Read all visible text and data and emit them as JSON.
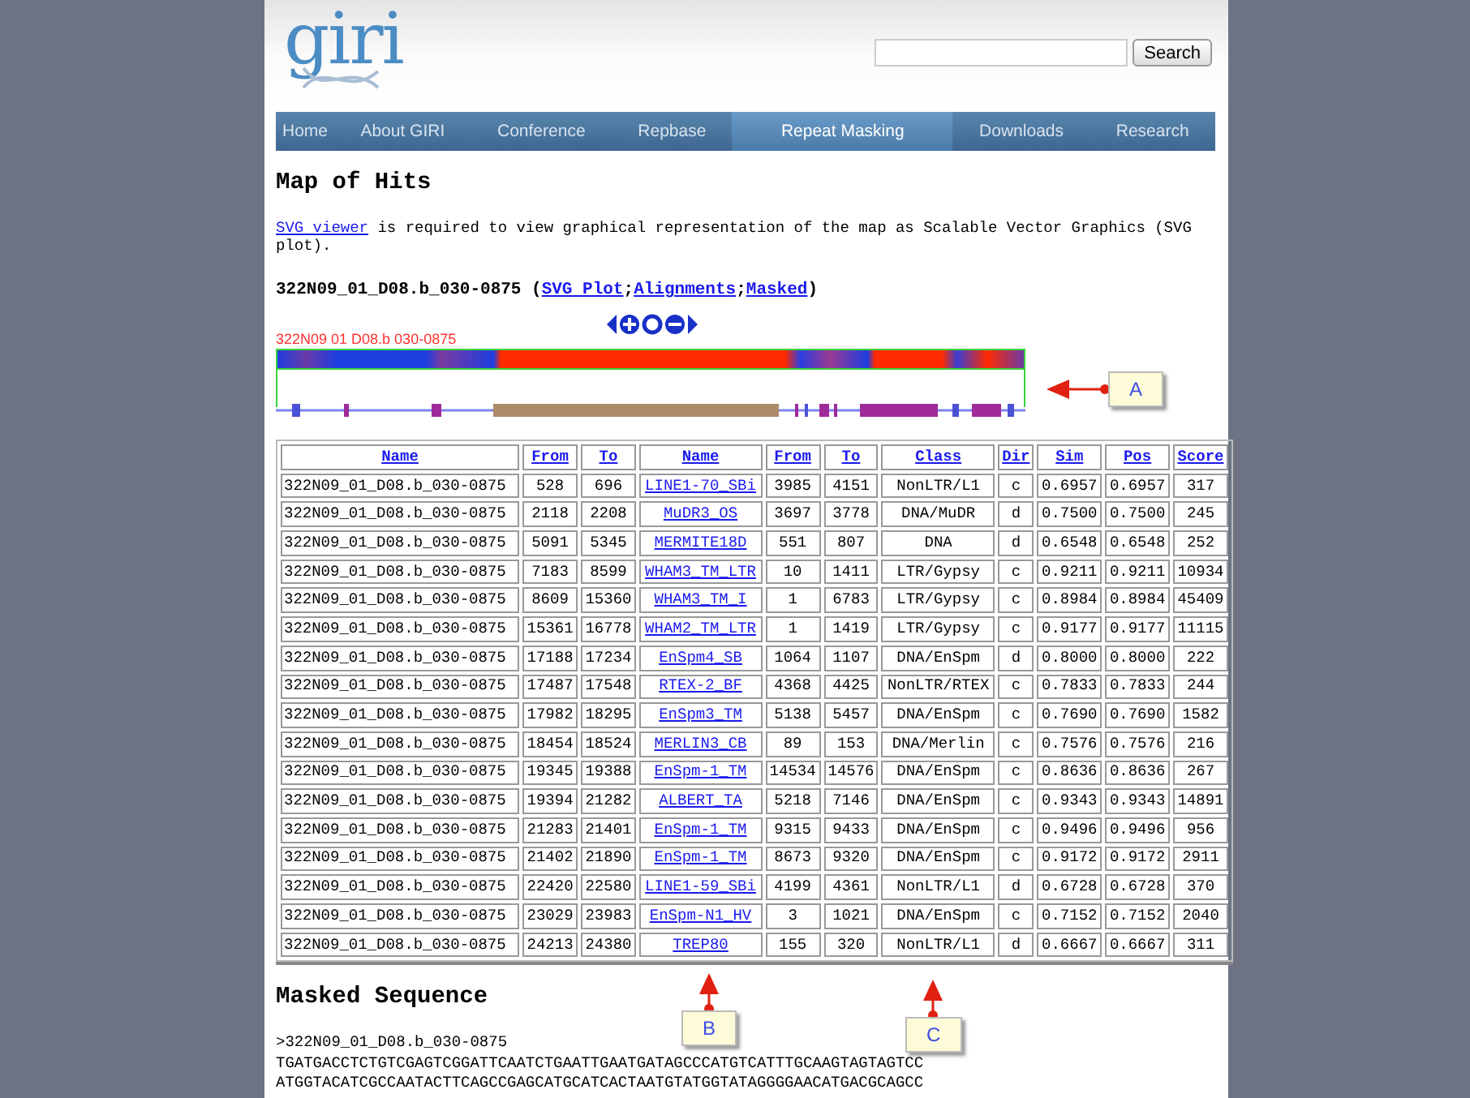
{
  "logo": "giri",
  "search": {
    "button": "Search"
  },
  "nav": [
    {
      "label": "Home",
      "selected": false
    },
    {
      "label": "About GIRI",
      "selected": false
    },
    {
      "label": "Conference",
      "selected": false
    },
    {
      "label": "Repbase",
      "selected": false
    },
    {
      "label": "Repeat Masking",
      "selected": true
    },
    {
      "label": "Downloads",
      "selected": false
    },
    {
      "label": "Research",
      "selected": false
    }
  ],
  "heading": "Map of Hits",
  "notice": {
    "link": "SVG viewer",
    "text": " is required to view graphical representation of the map as Scalable Vector Graphics (SVG plot)."
  },
  "sequence_title": {
    "name": "322N09_01_D08.b_030-0875",
    "open": "(",
    "links": [
      "SVG Plot",
      "Alignments",
      "Masked"
    ],
    "separator": ";",
    "close": ")"
  },
  "map": {
    "label": "322N09 01 D08.b 030-0875"
  },
  "callouts": [
    {
      "label": "A",
      "kind": "left"
    },
    {
      "label": "B",
      "kind": "up"
    },
    {
      "label": "C",
      "kind": "up"
    }
  ],
  "table": {
    "columns": [
      "Name",
      "From",
      "To",
      "Name",
      "From",
      "To",
      "Class",
      "Dir",
      "Sim",
      "Pos",
      "Score"
    ],
    "rows": [
      [
        "322N09_01_D08.b_030-0875",
        "528",
        "696",
        "LINE1-70_SBi",
        "3985",
        "4151",
        "NonLTR/L1",
        "c",
        "0.6957",
        "0.6957",
        "317"
      ],
      [
        "322N09_01_D08.b_030-0875",
        "2118",
        "2208",
        "MuDR3_OS",
        "3697",
        "3778",
        "DNA/MuDR",
        "d",
        "0.7500",
        "0.7500",
        "245"
      ],
      [
        "322N09_01_D08.b_030-0875",
        "5091",
        "5345",
        "MERMITE18D",
        "551",
        "807",
        "DNA",
        "d",
        "0.6548",
        "0.6548",
        "252"
      ],
      [
        "322N09_01_D08.b_030-0875",
        "7183",
        "8599",
        "WHAM3_TM_LTR",
        "10",
        "1411",
        "LTR/Gypsy",
        "c",
        "0.9211",
        "0.9211",
        "10934"
      ],
      [
        "322N09_01_D08.b_030-0875",
        "8609",
        "15360",
        "WHAM3_TM_I",
        "1",
        "6783",
        "LTR/Gypsy",
        "c",
        "0.8984",
        "0.8984",
        "45409"
      ],
      [
        "322N09_01_D08.b_030-0875",
        "15361",
        "16778",
        "WHAM2_TM_LTR",
        "1",
        "1419",
        "LTR/Gypsy",
        "c",
        "0.9177",
        "0.9177",
        "11115"
      ],
      [
        "322N09_01_D08.b_030-0875",
        "17188",
        "17234",
        "EnSpm4_SB",
        "1064",
        "1107",
        "DNA/EnSpm",
        "d",
        "0.8000",
        "0.8000",
        "222"
      ],
      [
        "322N09_01_D08.b_030-0875",
        "17487",
        "17548",
        "RTEX-2_BF",
        "4368",
        "4425",
        "NonLTR/RTEX",
        "c",
        "0.7833",
        "0.7833",
        "244"
      ],
      [
        "322N09_01_D08.b_030-0875",
        "17982",
        "18295",
        "EnSpm3_TM",
        "5138",
        "5457",
        "DNA/EnSpm",
        "c",
        "0.7690",
        "0.7690",
        "1582"
      ],
      [
        "322N09_01_D08.b_030-0875",
        "18454",
        "18524",
        "MERLIN3_CB",
        "89",
        "153",
        "DNA/Merlin",
        "c",
        "0.7576",
        "0.7576",
        "216"
      ],
      [
        "322N09_01_D08.b_030-0875",
        "19345",
        "19388",
        "EnSpm-1_TM",
        "14534",
        "14576",
        "DNA/EnSpm",
        "c",
        "0.8636",
        "0.8636",
        "267"
      ],
      [
        "322N09_01_D08.b_030-0875",
        "19394",
        "21282",
        "ALBERT_TA",
        "5218",
        "7146",
        "DNA/EnSpm",
        "c",
        "0.9343",
        "0.9343",
        "14891"
      ],
      [
        "322N09_01_D08.b_030-0875",
        "21283",
        "21401",
        "EnSpm-1_TM",
        "9315",
        "9433",
        "DNA/EnSpm",
        "c",
        "0.9496",
        "0.9496",
        "956"
      ],
      [
        "322N09_01_D08.b_030-0875",
        "21402",
        "21890",
        "EnSpm-1_TM",
        "8673",
        "9320",
        "DNA/EnSpm",
        "c",
        "0.9172",
        "0.9172",
        "2911"
      ],
      [
        "322N09_01_D08.b_030-0875",
        "22420",
        "22580",
        "LINE1-59_SBi",
        "4199",
        "4361",
        "NonLTR/L1",
        "d",
        "0.6728",
        "0.6728",
        "370"
      ],
      [
        "322N09_01_D08.b_030-0875",
        "23029",
        "23983",
        "EnSpm-N1_HV",
        "3",
        "1021",
        "DNA/EnSpm",
        "c",
        "0.7152",
        "0.7152",
        "2040"
      ],
      [
        "322N09_01_D08.b_030-0875",
        "24213",
        "24380",
        "TREP80",
        "155",
        "320",
        "NonLTR/L1",
        "d",
        "0.6667",
        "0.6667",
        "311"
      ]
    ]
  },
  "masked": {
    "heading": "Masked Sequence",
    "header": ">322N09_01_D08.b_030-0875",
    "lines": [
      "TGATGACCTCTGTCGAGTCGGATTCAATCTGAATTGAATGATAGCCCATGTCATTTGCAAGTAGTAGTCC",
      "ATGGTACATCGCCAATACTTCAGCCGAGCATGCATCACTAATGTATGGTATAGGGGAACATGACGCAGCC"
    ]
  }
}
